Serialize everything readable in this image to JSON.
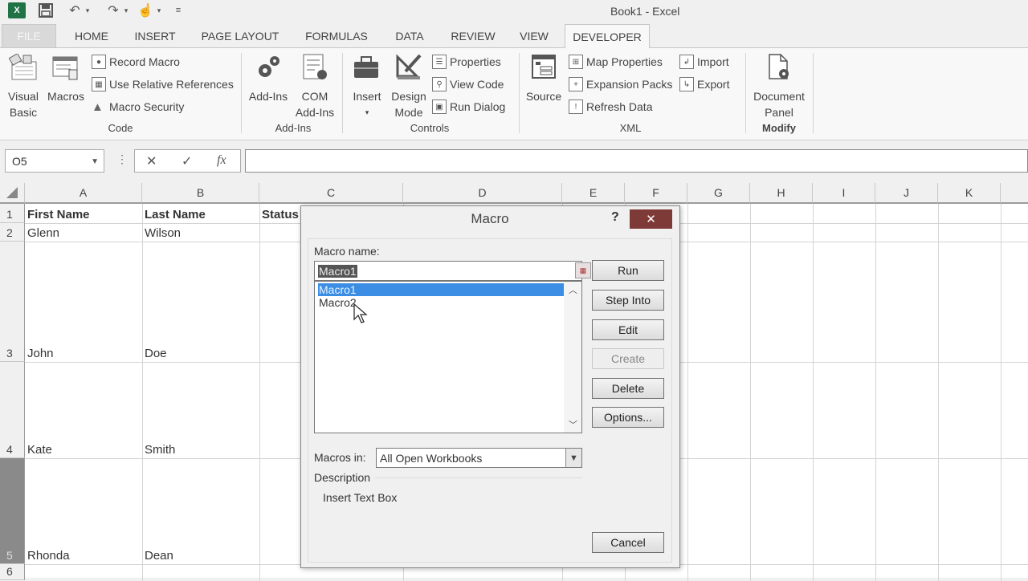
{
  "window": {
    "title": "Book1 - Excel"
  },
  "quick_access": {
    "app_icon": "excel-logo-icon",
    "app_icon_text": "X",
    "items": [
      "save-icon",
      "undo-icon",
      "redo-icon",
      "touch-mode-icon",
      "customize-qat-icon"
    ]
  },
  "tabs": [
    {
      "label": "FILE"
    },
    {
      "label": "HOME"
    },
    {
      "label": "INSERT"
    },
    {
      "label": "PAGE LAYOUT"
    },
    {
      "label": "FORMULAS"
    },
    {
      "label": "DATA"
    },
    {
      "label": "REVIEW"
    },
    {
      "label": "VIEW"
    },
    {
      "label": "DEVELOPER",
      "active": true
    }
  ],
  "ribbon": {
    "code": {
      "label": "Code",
      "visual_basic": "Visual Basic",
      "visual_basic_1": "Visual",
      "visual_basic_2": "Basic",
      "macros": "Macros",
      "record_macro": "Record Macro",
      "relative_refs": "Use Relative References",
      "macro_security": "Macro Security"
    },
    "addins": {
      "label": "Add-Ins",
      "addins": "Add-Ins",
      "com_1": "COM",
      "com_2": "Add-Ins"
    },
    "controls": {
      "label": "Controls",
      "insert": "Insert",
      "design_1": "Design",
      "design_2": "Mode",
      "properties": "Properties",
      "view_code": "View Code",
      "run_dialog": "Run Dialog"
    },
    "xml": {
      "label": "XML",
      "source": "Source",
      "map_properties": "Map Properties",
      "expansion_packs": "Expansion Packs",
      "refresh_data": "Refresh Data",
      "import": "Import",
      "export": "Export"
    },
    "modify": {
      "label": "Modify",
      "doc_1": "Document",
      "doc_2": "Panel"
    }
  },
  "formula_bar": {
    "name_box": "O5",
    "formula": "",
    "cancel": "✕",
    "enter": "✓",
    "fx": "fx"
  },
  "sheet": {
    "columns": [
      "A",
      "B",
      "C",
      "D",
      "E",
      "F",
      "G",
      "H",
      "I",
      "J",
      "K"
    ],
    "rows": [
      "1",
      "2",
      "3",
      "4",
      "5",
      "6"
    ],
    "cells": {
      "A1": "First Name",
      "B1": "Last Name",
      "C1": "Status",
      "A2": "Glenn",
      "B2": "Wilson",
      "A3": "John",
      "B3": "Doe",
      "A4": "Kate",
      "B4": "Smith",
      "A5": "Rhonda",
      "B5": "Dean"
    }
  },
  "dialog": {
    "title": "Macro",
    "help": "?",
    "close": "✕",
    "macro_name_label": "Macro name:",
    "macro_name_value": "Macro1",
    "macros": [
      "Macro1",
      "Macro2"
    ],
    "selected_macro": "Macro1",
    "buttons": {
      "run": "Run",
      "step_into": "Step Into",
      "edit": "Edit",
      "create": "Create",
      "delete": "Delete",
      "options": "Options...",
      "cancel": "Cancel"
    },
    "macros_in_label": "Macros in:",
    "macros_in_value": "All Open Workbooks",
    "description_label": "Description",
    "description_value": "Insert Text Box"
  },
  "colors": {
    "accent_green": "#217346",
    "close_red": "#7e3a36",
    "selection_blue": "#3b8ee4"
  }
}
